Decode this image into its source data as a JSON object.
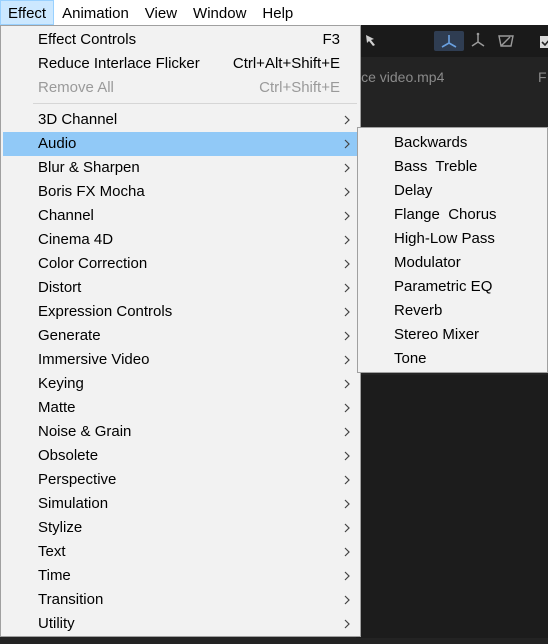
{
  "menubar": {
    "items": [
      "Effect",
      "Animation",
      "View",
      "Window",
      "Help"
    ]
  },
  "background": {
    "tab_label": "ice video.mp4",
    "tab_label_2": "F"
  },
  "effect_menu": {
    "top_items": [
      {
        "label": "Effect Controls",
        "shortcut": "F3"
      },
      {
        "label": "Reduce Interlace Flicker",
        "shortcut": "Ctrl+Alt+Shift+E"
      },
      {
        "label": "Remove All",
        "shortcut": "Ctrl+Shift+E",
        "disabled": true
      }
    ],
    "categories": [
      "3D Channel",
      "Audio",
      "Blur & Sharpen",
      "Boris FX Mocha",
      "Channel",
      "Cinema 4D",
      "Color Correction",
      "Distort",
      "Expression Controls",
      "Generate",
      "Immersive Video",
      "Keying",
      "Matte",
      "Noise & Grain",
      "Obsolete",
      "Perspective",
      "Simulation",
      "Stylize",
      "Text",
      "Time",
      "Transition",
      "Utility"
    ],
    "highlighted": "Audio"
  },
  "audio_submenu": {
    "items": [
      "Backwards",
      "Bass  Treble",
      "Delay",
      "Flange  Chorus",
      "High-Low Pass",
      "Modulator",
      "Parametric EQ",
      "Reverb",
      "Stereo Mixer",
      "Tone"
    ]
  },
  "colors": {
    "highlight": "#91c9f7",
    "menu_bg": "#f2f2f2",
    "menubar_active": "#cce8ff",
    "disabled_text": "#9a9a9a"
  }
}
